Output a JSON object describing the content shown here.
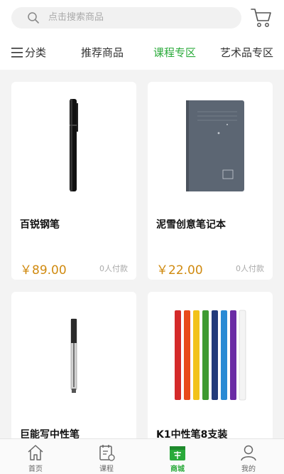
{
  "search": {
    "placeholder": "点击搜索商品"
  },
  "icons": {
    "search": "search-icon",
    "cart": "cart-icon",
    "menu": "menu-icon"
  },
  "tabs": [
    {
      "label": "分类"
    },
    {
      "label": "推荐商品"
    },
    {
      "label": "课程专区",
      "active": true
    },
    {
      "label": "艺术品专区"
    }
  ],
  "accent_color": "#2aaa3a",
  "price_color": "#d08a10",
  "products": [
    {
      "name": "百锐钢笔",
      "price": "￥89.00",
      "sold": "0人付款"
    },
    {
      "name": "泥雪创意笔记本",
      "price": "￥22.00",
      "sold": "0人付款"
    },
    {
      "name": "巨能写中性笔",
      "price": "",
      "sold": ""
    },
    {
      "name": "K1中性笔8支装",
      "price": "",
      "sold": ""
    }
  ],
  "bottom_nav": [
    {
      "label": "首页",
      "icon": "home-icon"
    },
    {
      "label": "课程",
      "icon": "course-icon"
    },
    {
      "label": "商城",
      "icon": "mall-icon",
      "active": true
    },
    {
      "label": "我的",
      "icon": "profile-icon"
    }
  ]
}
